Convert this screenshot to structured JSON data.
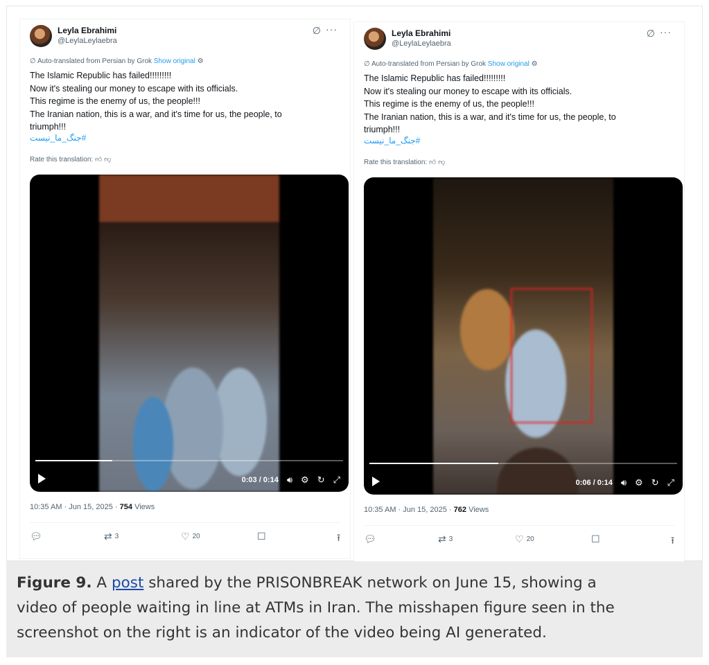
{
  "tweets": [
    {
      "name": "Leyla Ebrahimi",
      "handle": "@LeylaLeylaebra",
      "translated_prefix": "Auto-translated from Persian by Grok",
      "show_original": "Show original",
      "lines": [
        "The Islamic Republic has failed!!!!!!!!!",
        "Now it's stealing our money to escape with its officials.",
        "This regime is the enemy of us, the people!!!",
        "The Iranian nation, this is a war, and it's time for us, the people, to",
        "triumph!!!"
      ],
      "hashtag": "#جنگ_ما_نیست",
      "rate": "Rate this translation:",
      "time_display": "0:03 / 0:14",
      "progress": 0.25,
      "timestamp": "10:35 AM · Jun 15, 2025 · ",
      "views": "754",
      "views_label": "Views",
      "retweets": "3",
      "likes": "20"
    },
    {
      "name": "Leyla Ebrahimi",
      "handle": "@LeylaLeylaebra",
      "translated_prefix": "Auto-translated from Persian by Grok",
      "show_original": "Show original",
      "lines": [
        "The Islamic Republic has failed!!!!!!!!!",
        "Now it's stealing our money to escape with its officials.",
        "This regime is the enemy of us, the people!!!",
        "The Iranian nation, this is a war, and it's time for us, the people, to",
        "triumph!!!"
      ],
      "hashtag": "#جنگ_ما_نیست",
      "rate": "Rate this translation:",
      "time_display": "0:06 / 0:14",
      "progress": 0.42,
      "timestamp": "10:35 AM · Jun 15, 2025 · ",
      "views": "762",
      "views_label": "Views",
      "retweets": "3",
      "likes": "20"
    }
  ],
  "caption": {
    "figure_label": "Figure 9.",
    "before_link": " A ",
    "link_text": "post",
    "line1_rest": " shared by the PRISONBREAK network on June 15, showing a",
    "line2": "video of people waiting in line at ATMs in Iran. The misshapen figure seen in the",
    "line3": "screenshot on the right is an indicator of the video being AI generated."
  },
  "icons": {
    "grok": "grok-icon",
    "more": "more-icon",
    "reply": "reply-icon",
    "retweet": "retweet-icon",
    "like": "heart-icon",
    "bookmark": "bookmark-icon",
    "share": "share-icon"
  },
  "colors": {
    "link": "#1d9bf0",
    "highlight_box": "#e02020"
  }
}
